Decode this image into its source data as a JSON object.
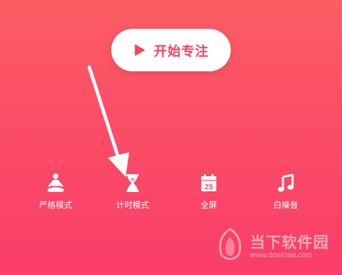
{
  "start_button": {
    "label": "开始专注",
    "icon": "play-icon"
  },
  "modes": [
    {
      "label": "严格模式",
      "icon": "meditation-icon"
    },
    {
      "label": "计时模式",
      "icon": "hourglass-icon"
    },
    {
      "label": "全屏",
      "icon": "calendar-icon",
      "badge": "25"
    },
    {
      "label": "白噪音",
      "icon": "music-note-icon"
    }
  ],
  "watermark": {
    "name": "当下软件园",
    "url": "www.downxia.com"
  },
  "colors": {
    "background_top": "#fc5d63",
    "background_bottom": "#fa3d69",
    "accent": "#fa4261",
    "white": "#ffffff"
  }
}
